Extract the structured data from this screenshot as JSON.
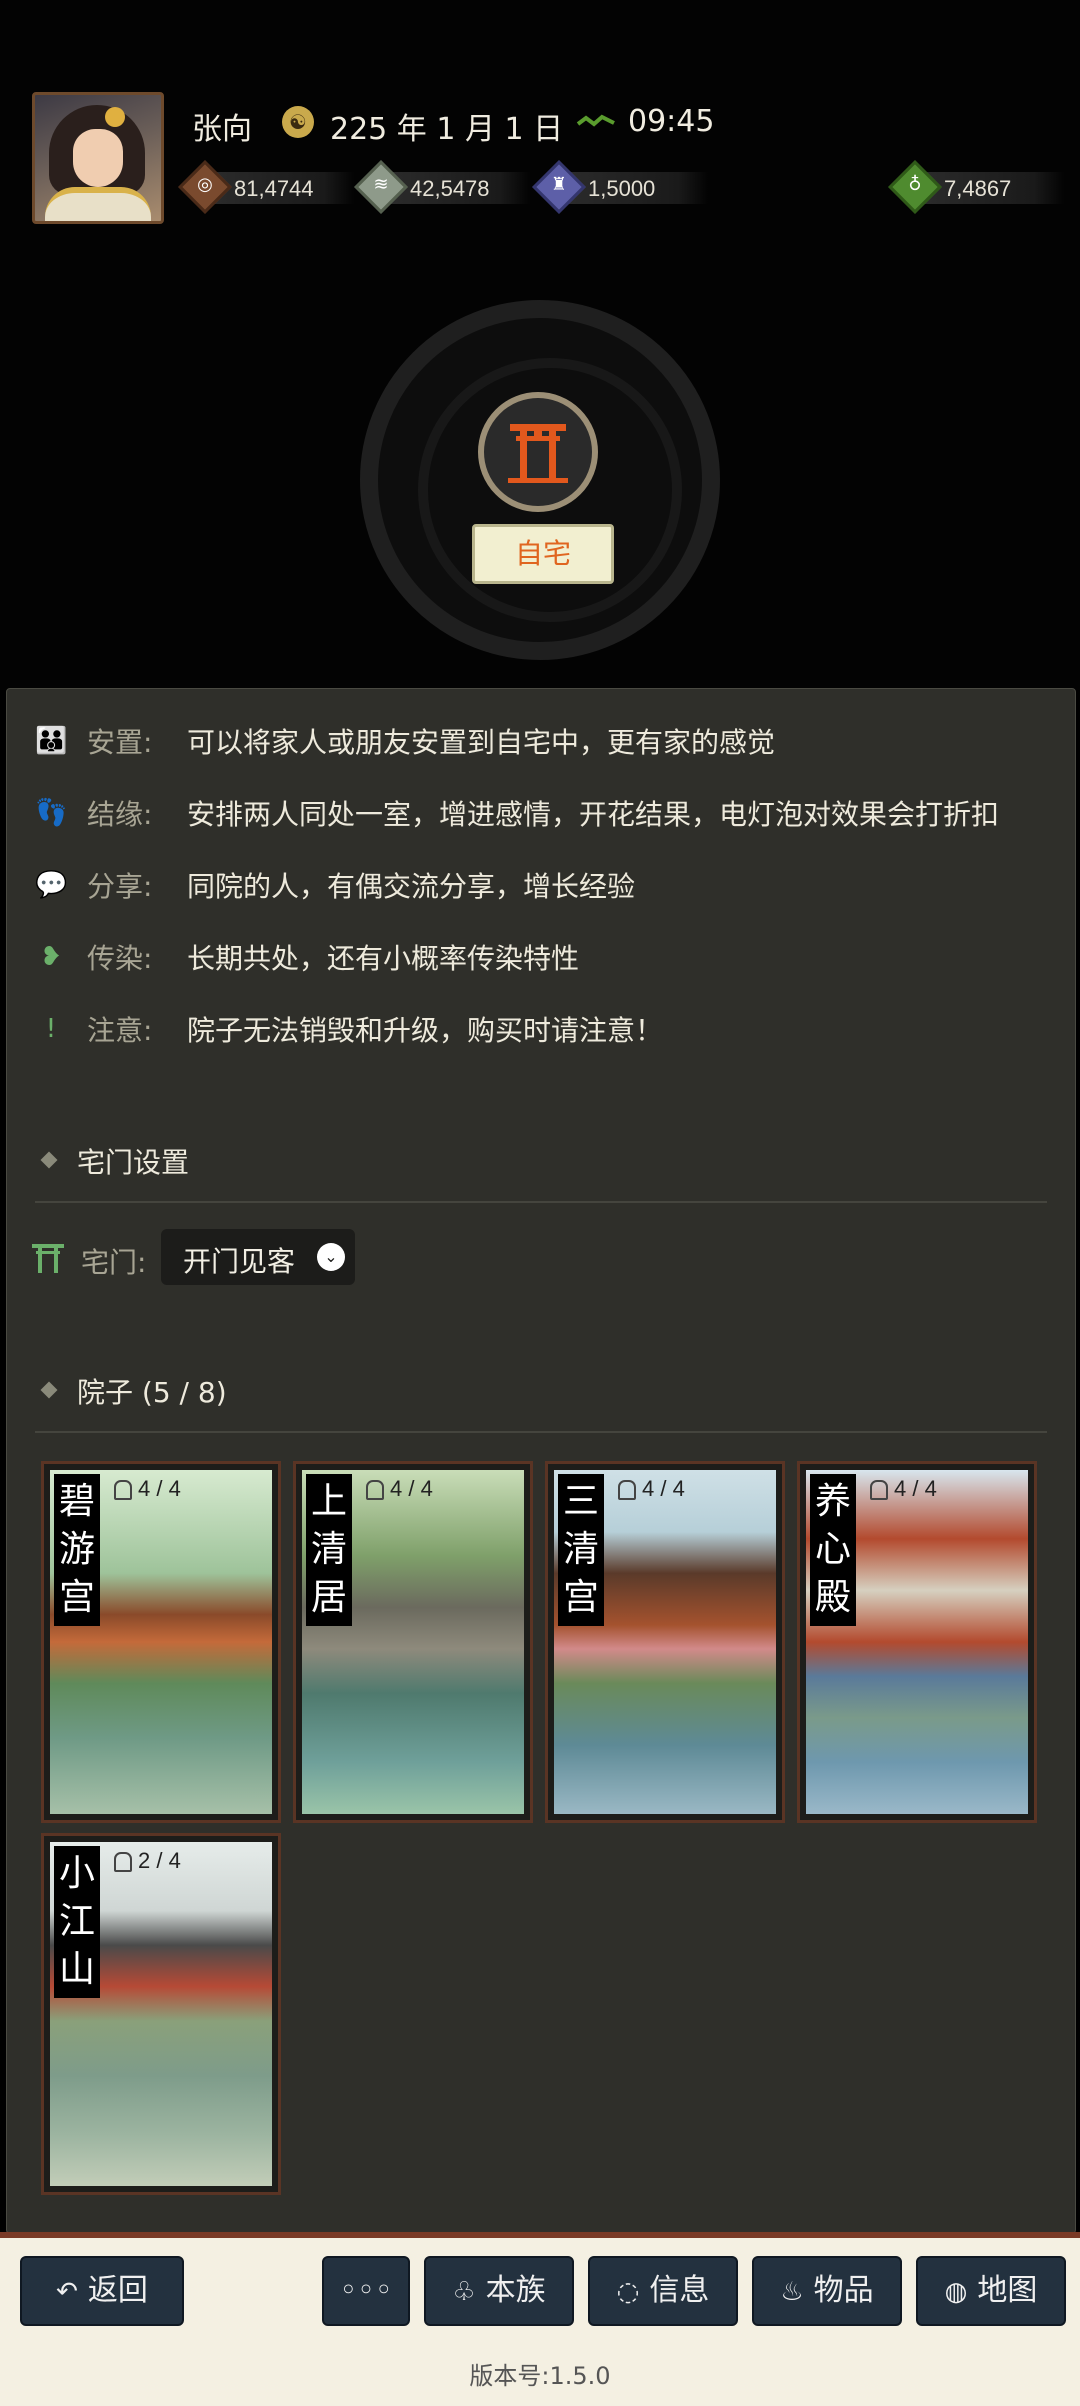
{
  "player": {
    "name": "张向",
    "date": "225 年 1 月 1 日",
    "time": "09:45"
  },
  "resources": [
    {
      "icon": "coin-icon",
      "value": "81,4744",
      "color": "#7a4a2e"
    },
    {
      "icon": "grain-icon",
      "value": "42,5478",
      "color": "#8e9a8a"
    },
    {
      "icon": "soldier-icon",
      "value": "1,5000",
      "color": "#5d5fa8"
    },
    {
      "icon": "money-bag-icon",
      "value": "7,4867",
      "color": "#4f8b2f"
    }
  ],
  "home": {
    "tag": "自宅"
  },
  "features": [
    {
      "icon": "family-icon",
      "label": "安置:",
      "text": "可以将家人或朋友安置到自宅中，更有家的感觉"
    },
    {
      "icon": "footprints-icon",
      "label": "结缘:",
      "text": "安排两人同处一室，增进感情，开花结果，电灯泡对效果会打折扣"
    },
    {
      "icon": "chat-icon",
      "label": "分享:",
      "text": "同院的人，有偶交流分享，增长经验"
    },
    {
      "icon": "broken-heart-icon",
      "label": "传染:",
      "text": "长期共处，还有小概率传染特性"
    },
    {
      "icon": "exclamation-icon",
      "label": "注意:",
      "text": "院子无法销毁和升级，购买时请注意！"
    }
  ],
  "gate_settings": {
    "title": "宅门设置",
    "label": "宅门:",
    "value": "开门见客"
  },
  "courtyards": {
    "title": "院子 (5 / 8)",
    "items": [
      {
        "name": "碧游宫",
        "capacity": "4 / 4"
      },
      {
        "name": "上清居",
        "capacity": "4 / 4"
      },
      {
        "name": "三清宫",
        "capacity": "4 / 4"
      },
      {
        "name": "养心殿",
        "capacity": "4 / 4"
      },
      {
        "name": "小江山",
        "capacity": "2 / 4"
      }
    ]
  },
  "nav": {
    "back": "返回",
    "more": "◦◦◦",
    "clan": "本族",
    "info": "信息",
    "items": "物品",
    "map": "地图"
  },
  "version": "版本号:1.5.0"
}
